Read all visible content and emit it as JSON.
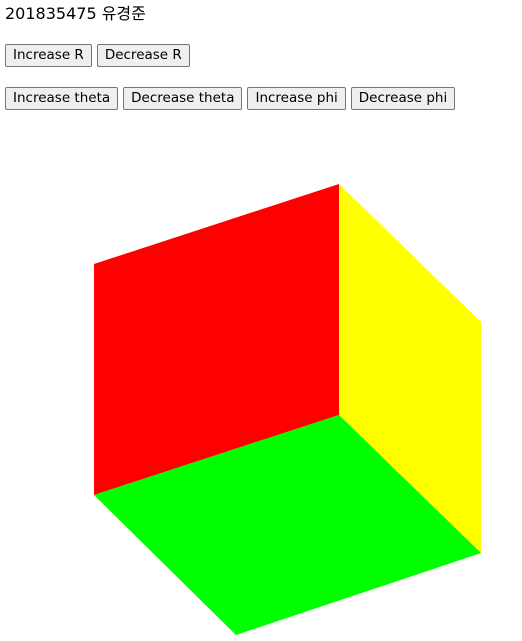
{
  "header": {
    "title": "201835475 유경준"
  },
  "controls": {
    "radius": {
      "increase_label": "Increase R",
      "decrease_label": "Decrease R"
    },
    "theta": {
      "increase_label": "Increase theta",
      "decrease_label": "Decrease theta"
    },
    "phi": {
      "increase_label": "Increase phi",
      "decrease_label": "Decrease phi"
    }
  },
  "scene": {
    "faces": [
      {
        "name": "red-face",
        "color": "#ff0000"
      },
      {
        "name": "yellow-face",
        "color": "#ffff00"
      },
      {
        "name": "green-face",
        "color": "#00ff00"
      }
    ]
  }
}
